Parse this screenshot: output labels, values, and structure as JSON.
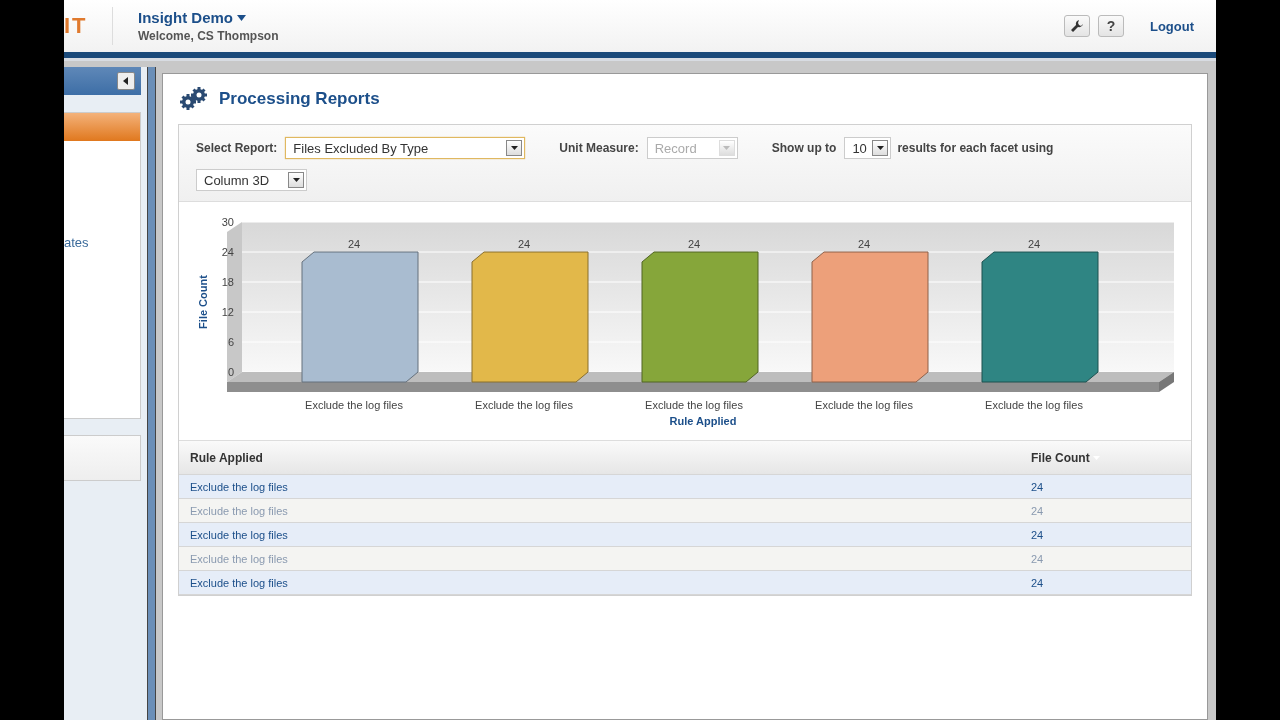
{
  "header": {
    "logo": "IT",
    "workspace": "Insight Demo",
    "welcome": "Welcome, CS Thompson",
    "help": "?",
    "logout": "Logout"
  },
  "sidebar": {
    "item_text": "ates"
  },
  "page": {
    "title": "Processing Reports"
  },
  "filters": [
    {
      "kind": "select",
      "label": "Select Report:",
      "value": "Files Excluded By Type",
      "focused": true,
      "disabled": false
    },
    {
      "kind": "select",
      "label": "Unit Measure:",
      "value": "Record",
      "focused": false,
      "disabled": true
    },
    {
      "kind": "select",
      "label": "Show up to",
      "value": "10",
      "suffix": "results for each facet using",
      "focused": false,
      "disabled": false
    },
    {
      "kind": "select",
      "value": "Column 3D",
      "focused": false,
      "disabled": false
    }
  ],
  "chart_data": {
    "type": "bar",
    "xlabel": "Rule Applied",
    "ylabel": "File Count",
    "categories": [
      "Exclude the log files",
      "Exclude the log files",
      "Exclude the log files",
      "Exclude the log files",
      "Exclude the log files"
    ],
    "series": [
      {
        "values": [
          24,
          24,
          24,
          24,
          24
        ]
      }
    ],
    "colors": [
      "#a9bcd0",
      "#e2b84a",
      "#86a63a",
      "#eda07a",
      "#2f8583"
    ],
    "ylim": [
      0,
      30
    ],
    "yticks": [
      0,
      6,
      12,
      18,
      24,
      30
    ],
    "grid": true,
    "data_labels": true
  },
  "table": {
    "columns": [
      "Rule Applied",
      "File Count"
    ],
    "rows": [
      [
        "Exclude the log files",
        "24"
      ],
      [
        "Exclude the log files",
        "24"
      ],
      [
        "Exclude the log files",
        "24"
      ],
      [
        "Exclude the log files",
        "24"
      ],
      [
        "Exclude the log files",
        "24"
      ]
    ]
  }
}
